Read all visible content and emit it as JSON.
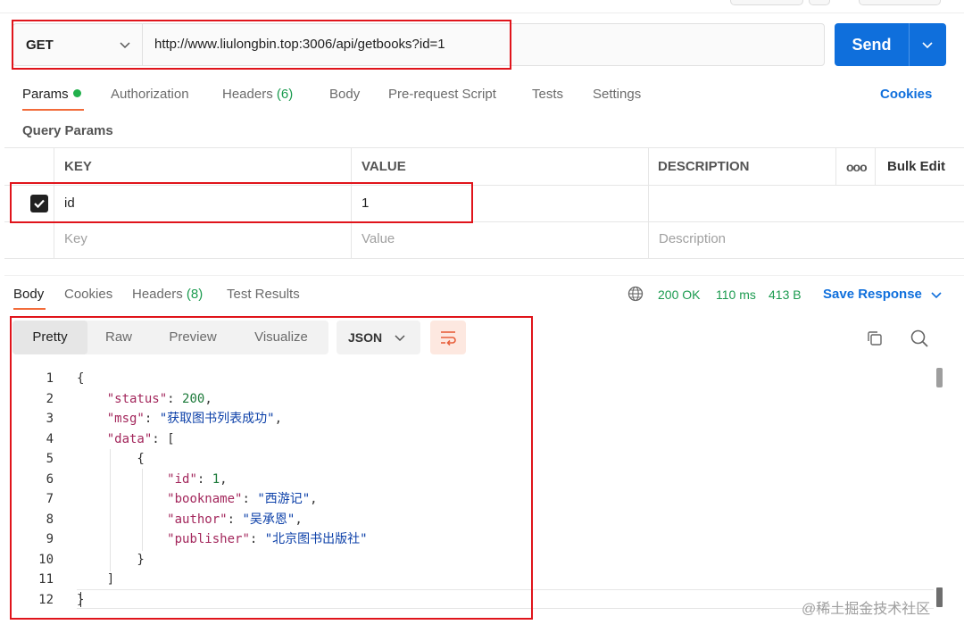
{
  "request": {
    "method": "GET",
    "url": "http://www.liulongbin.top:3006/api/getbooks?id=1",
    "send_label": "Send"
  },
  "request_tabs": [
    {
      "label": "Params",
      "active": true,
      "indicator": true
    },
    {
      "label": "Authorization"
    },
    {
      "label": "Headers",
      "count": "(6)"
    },
    {
      "label": "Body"
    },
    {
      "label": "Pre-request Script"
    },
    {
      "label": "Tests"
    },
    {
      "label": "Settings"
    }
  ],
  "cookies_link": "Cookies",
  "query_params": {
    "title": "Query Params",
    "columns": [
      "KEY",
      "VALUE",
      "DESCRIPTION"
    ],
    "more_label": "ooo",
    "bulk_edit": "Bulk Edit",
    "rows": [
      {
        "checked": true,
        "key": "id",
        "value": "1",
        "description": ""
      }
    ],
    "placeholders": {
      "key": "Key",
      "value": "Value",
      "description": "Description"
    }
  },
  "response": {
    "tabs": [
      {
        "label": "Body",
        "active": true
      },
      {
        "label": "Cookies"
      },
      {
        "label": "Headers",
        "count": "(8)"
      },
      {
        "label": "Test Results"
      }
    ],
    "status": "200 OK",
    "time": "110 ms",
    "size": "413 B",
    "save_label": "Save Response",
    "views": [
      "Pretty",
      "Raw",
      "Preview",
      "Visualize"
    ],
    "format": "JSON"
  },
  "code": {
    "line_numbers": [
      "1",
      "2",
      "3",
      "4",
      "5",
      "6",
      "7",
      "8",
      "9",
      "10",
      "11",
      "12"
    ],
    "status_key": "\"status\"",
    "status_val": "200",
    "msg_key": "\"msg\"",
    "msg_val": "\"获取图书列表成功\"",
    "data_key": "\"data\"",
    "id_key": "\"id\"",
    "id_val": "1",
    "bookname_key": "\"bookname\"",
    "bookname_val": "\"西游记\"",
    "author_key": "\"author\"",
    "author_val": "\"吴承恩\"",
    "publisher_key": "\"publisher\"",
    "publisher_val": "\"北京图书出版社\""
  },
  "watermark": "@稀土掘金技术社区",
  "colors": {
    "accent": "#0f6fdc",
    "tab_indicator": "#f26b3a",
    "status_green": "#1c9b50",
    "highlight": "#e0141b"
  }
}
